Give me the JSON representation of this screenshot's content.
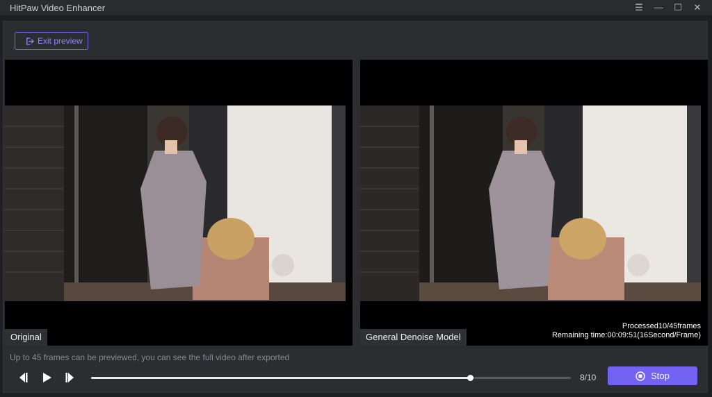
{
  "window": {
    "title": "HitPaw Video Enhancer",
    "controls": [
      "menu-icon",
      "minimize-icon",
      "maximize-icon",
      "close-icon"
    ]
  },
  "toolbar": {
    "exit_label": "Exit preview"
  },
  "panes": {
    "left": {
      "label": "Original"
    },
    "right": {
      "label": "General Denoise Model",
      "processed": "Processed10/45frames",
      "remaining": "Remaining time:00:09:51(16Second/Frame)"
    }
  },
  "hint": "Up to 45 frames can be previewed, you can see the full video after exported",
  "player": {
    "progress_fraction": 0.79,
    "counter": "8/10",
    "stop_label": "Stop"
  },
  "colors": {
    "accent": "#7463f2",
    "accent_border": "#7b6cf3"
  }
}
